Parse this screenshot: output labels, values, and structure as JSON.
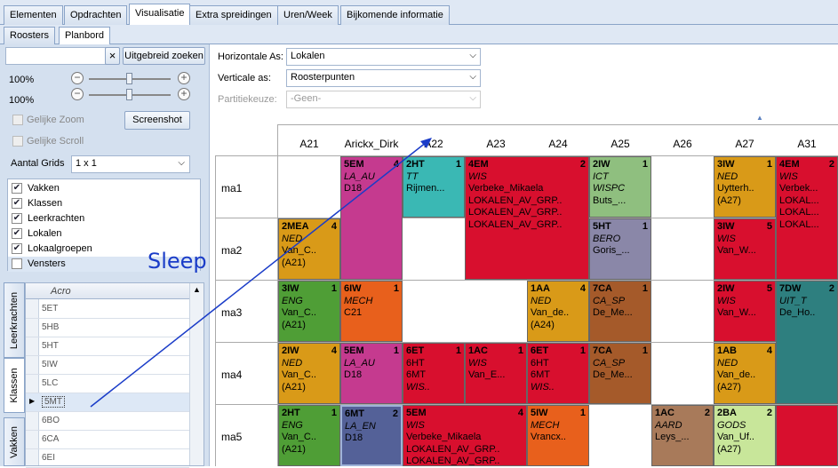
{
  "tabs": [
    "Elementen",
    "Opdrachten",
    "Visualisatie",
    "Extra spreidingen",
    "Uren/Week",
    "Bijkomende informatie"
  ],
  "subtabs": [
    "Roosters",
    "Planbord"
  ],
  "left": {
    "search_value": "",
    "clear_symbol": "×",
    "advanced_search": "Uitgebreid zoeken",
    "zoom1": "100%",
    "zoom2": "100%",
    "minus": "−",
    "plus": "+",
    "equal_zoom": "Gelijke Zoom",
    "screenshot": "Screenshot",
    "equal_scroll": "Gelijke Scroll",
    "grid_count_label": "Aantal Grids",
    "grid_count_value": "1 x 1",
    "items": [
      {
        "label": "Vakken",
        "checked": true
      },
      {
        "label": "Klassen",
        "checked": true
      },
      {
        "label": "Leerkrachten",
        "checked": true
      },
      {
        "label": "Lokalen",
        "checked": true
      },
      {
        "label": "Lokaalgroepen",
        "checked": true
      },
      {
        "label": "Vensters",
        "checked": false
      }
    ],
    "vtabs": [
      "Leerkrachten",
      "Klassen",
      "Vakken"
    ],
    "grid_header": "Acro",
    "grid_rows": [
      "5ET",
      "5HB",
      "5HT",
      "5IW",
      "5LC",
      "5MT",
      "6BO",
      "6CA",
      "6EI"
    ],
    "selected_row": "5MT"
  },
  "right": {
    "h_axis_label": "Horizontale As:",
    "h_axis_value": "Lokalen",
    "v_axis_label": "Verticale as:",
    "v_axis_value": "Roosterpunten",
    "partition_label": "Partitiekeuze:",
    "partition_value": "-Geen-",
    "columns": [
      "A21",
      "Arickx_Dirk",
      "A22",
      "A23",
      "A24",
      "A25",
      "A26",
      "A27",
      "A31"
    ],
    "rows": [
      "ma1",
      "ma2",
      "ma3",
      "ma4",
      "ma5"
    ]
  },
  "annotation": "Sleep",
  "cells": [
    {
      "t": "5EM",
      "n": "4",
      "l": [
        "LA_AU",
        "D18"
      ],
      "it": [
        0
      ],
      "color": "#c53a8f"
    },
    {
      "t": "2HT",
      "n": "1",
      "l": [
        "TT",
        "Rijmen..."
      ],
      "it": [
        0
      ],
      "color": "#3ab8b4"
    },
    {
      "t": "4EM",
      "n": "2",
      "l": [
        "WIS",
        "Verbeke_Mikaela",
        "LOKALEN_AV_GRP..",
        "LOKALEN_AV_GRP..",
        "LOKALEN_AV_GRP.."
      ],
      "it": [
        0
      ],
      "color": "#d80f2e"
    },
    {
      "t": "2IW",
      "n": "1",
      "l": [
        "ICT",
        "WISPC",
        "Buts_..."
      ],
      "it": [
        0,
        1
      ],
      "color": "#8fbf7f"
    },
    {
      "t": "3IW",
      "n": "1",
      "l": [
        "NED",
        "Uytterh..",
        "(A27)"
      ],
      "it": [
        0
      ],
      "color": "#d99a18"
    },
    {
      "t": "4EM",
      "n": "2",
      "l": [
        "WIS",
        "Verbek...",
        "LOKAL...",
        "LOKAL...",
        "LOKAL..."
      ],
      "it": [
        0
      ],
      "color": "#d80f2e"
    },
    {
      "t": "2MEA",
      "n": "4",
      "l": [
        "NED",
        "Van_C..",
        "(A21)"
      ],
      "it": [
        0
      ],
      "color": "#d99a18"
    },
    {
      "t": "5HT",
      "n": "1",
      "l": [
        "BERO",
        "Goris_..."
      ],
      "it": [
        0
      ],
      "color": "#8a87a8"
    },
    {
      "t": "3IW",
      "n": "5",
      "l": [
        "WIS",
        "Van_W..."
      ],
      "it": [
        0
      ],
      "color": "#d80f2e"
    },
    {
      "t": "3IW",
      "n": "1",
      "l": [
        "ENG",
        "Van_C..",
        "(A21)"
      ],
      "it": [
        0
      ],
      "color": "#4f9e36"
    },
    {
      "t": "6IW",
      "n": "1",
      "l": [
        "MECH",
        "C21"
      ],
      "it": [
        0
      ],
      "color": "#e8601c"
    },
    {
      "t": "1AA",
      "n": "4",
      "l": [
        "NED",
        "Van_de..",
        "(A24)"
      ],
      "it": [
        0
      ],
      "color": "#d99a18"
    },
    {
      "t": "7CA",
      "n": "1",
      "l": [
        "CA_SP",
        "De_Me..."
      ],
      "it": [
        0
      ],
      "color": "#a55a2a"
    },
    {
      "t": "2IW",
      "n": "5",
      "l": [
        "WIS",
        "Van_W..."
      ],
      "it": [
        0
      ],
      "color": "#d80f2e"
    },
    {
      "t": "7DW",
      "n": "2",
      "l": [
        "UIT_T",
        "De_Ho.."
      ],
      "it": [
        0
      ],
      "color": "#2e7f7f"
    },
    {
      "t": "2IW",
      "n": "4",
      "l": [
        "NED",
        "Van_C..",
        "(A21)"
      ],
      "it": [
        0
      ],
      "color": "#d99a18"
    },
    {
      "t": "5EM",
      "n": "1",
      "l": [
        "LA_AU",
        "D18"
      ],
      "it": [
        0
      ],
      "color": "#c53a8f"
    },
    {
      "t": "6ET",
      "n": "1",
      "l": [
        "6HT",
        "6MT",
        "WIS.."
      ],
      "it": [
        2
      ],
      "color": "#d80f2e"
    },
    {
      "t": "1AC",
      "n": "1",
      "l": [
        "WIS",
        "Van_E..."
      ],
      "it": [
        0
      ],
      "color": "#d80f2e"
    },
    {
      "t": "6ET",
      "n": "1",
      "l": [
        "6HT",
        "6MT",
        "WIS.."
      ],
      "it": [
        2
      ],
      "color": "#d80f2e"
    },
    {
      "t": "7CA",
      "n": "1",
      "l": [
        "CA_SP",
        "De_Me..."
      ],
      "it": [
        0
      ],
      "color": "#a55a2a"
    },
    {
      "t": "1AB",
      "n": "4",
      "l": [
        "NED",
        "Van_de..",
        "(A27)"
      ],
      "it": [
        0
      ],
      "color": "#d99a18"
    },
    {
      "t": "2HT",
      "n": "1",
      "l": [
        "ENG",
        "Van_C..",
        "(A21)"
      ],
      "it": [
        0
      ],
      "color": "#4f9e36"
    },
    {
      "t": "6MT",
      "n": "2",
      "l": [
        "LA_EN",
        "D18"
      ],
      "it": [
        0
      ],
      "color": "#546198"
    },
    {
      "t": "5EM",
      "n": "4",
      "l": [
        "WIS",
        "Verbeke_Mikaela",
        "LOKALEN_AV_GRP..",
        "LOKALEN_AV_GRP.."
      ],
      "it": [
        0
      ],
      "color": "#d80f2e"
    },
    {
      "t": "5IW",
      "n": "1",
      "l": [
        "MECH",
        "Vrancx.."
      ],
      "it": [
        0
      ],
      "color": "#e8601c"
    },
    {
      "t": "1AC",
      "n": "2",
      "l": [
        "AARD",
        "Leys_..."
      ],
      "it": [
        0
      ],
      "color": "#a87a5a"
    },
    {
      "t": "2BA",
      "n": "2",
      "l": [
        "GODS",
        "Van_Uf..",
        "(A27)"
      ],
      "it": [
        0
      ],
      "color": "#c8e69a"
    },
    {
      "t": "",
      "n": "",
      "l": [],
      "it": [],
      "color": "#d80f2e"
    }
  ]
}
